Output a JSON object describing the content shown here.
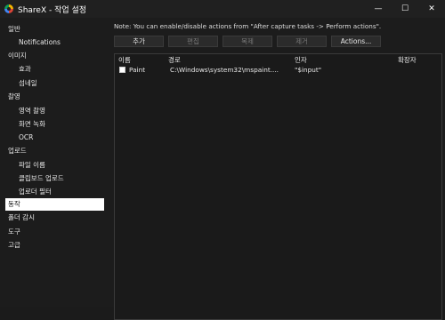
{
  "window": {
    "title": "ShareX - 작업 설정",
    "icon": "sharex-icon",
    "minimize": "—",
    "maximize": "☐",
    "close": "✕"
  },
  "sidebar": {
    "items": [
      {
        "label": "일반",
        "indent": 0,
        "selected": false
      },
      {
        "label": "Notifications",
        "indent": 1,
        "selected": false
      },
      {
        "label": "이미지",
        "indent": 0,
        "selected": false
      },
      {
        "label": "효과",
        "indent": 1,
        "selected": false
      },
      {
        "label": "섬네일",
        "indent": 1,
        "selected": false
      },
      {
        "label": "촬영",
        "indent": 0,
        "selected": false
      },
      {
        "label": "영역 촬영",
        "indent": 1,
        "selected": false
      },
      {
        "label": "화면 녹화",
        "indent": 1,
        "selected": false
      },
      {
        "label": "OCR",
        "indent": 1,
        "selected": false
      },
      {
        "label": "업로드",
        "indent": 0,
        "selected": false
      },
      {
        "label": "파일 이름",
        "indent": 1,
        "selected": false
      },
      {
        "label": "클립보드 업로드",
        "indent": 1,
        "selected": false
      },
      {
        "label": "업로더 필터",
        "indent": 1,
        "selected": false
      },
      {
        "label": "동작",
        "indent": 0,
        "selected": true
      },
      {
        "label": "폴더 감시",
        "indent": 0,
        "selected": false
      },
      {
        "label": "도구",
        "indent": 0,
        "selected": false
      },
      {
        "label": "고급",
        "indent": 0,
        "selected": false
      }
    ]
  },
  "main": {
    "note": "Note: You can enable/disable actions from \"After capture tasks -> Perform actions\".",
    "buttons": {
      "add": "추가",
      "edit": "편집",
      "duplicate": "복제",
      "remove": "제거",
      "actions": "Actions..."
    },
    "table": {
      "columns": [
        "이름",
        "경로",
        "인자",
        "확장자"
      ],
      "rows": [
        {
          "checked": false,
          "name": "Paint",
          "path": "C:\\Windows\\system32\\mspaint....",
          "args": "\"$input\"",
          "ext": ""
        }
      ]
    }
  }
}
